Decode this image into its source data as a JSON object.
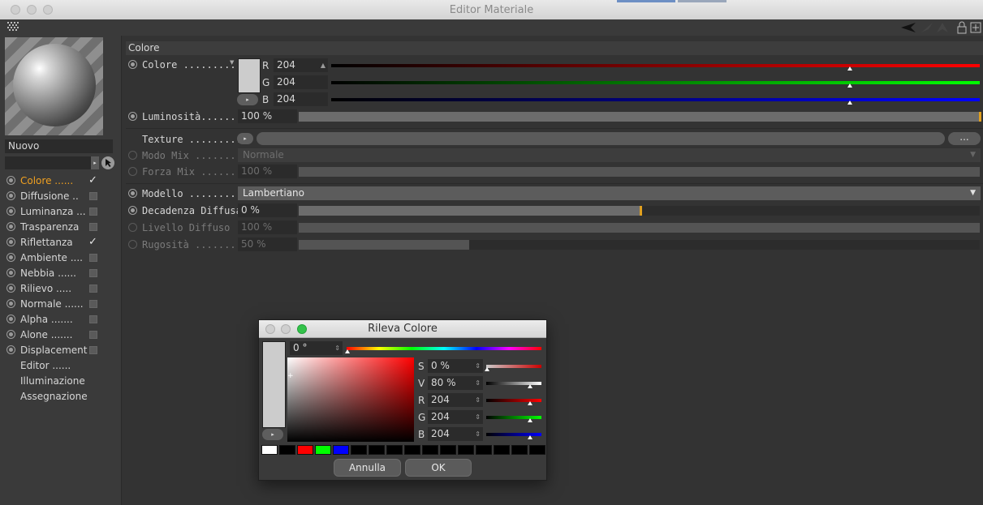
{
  "window": {
    "title": "Editor Materiale"
  },
  "material": {
    "name": "Nuovo"
  },
  "channels": [
    {
      "label": "Colore ......",
      "checked": true,
      "active": true
    },
    {
      "label": "Diffusione ..",
      "checked": false
    },
    {
      "label": "Luminanza ...",
      "checked": false
    },
    {
      "label": "Trasparenza",
      "checked": false
    },
    {
      "label": "Riflettanza",
      "checked": true
    },
    {
      "label": "Ambiente ....",
      "checked": false
    },
    {
      "label": "Nebbia ......",
      "checked": false
    },
    {
      "label": "Rilievo .....",
      "checked": false
    },
    {
      "label": "Normale ......",
      "checked": false
    },
    {
      "label": "Alpha .......",
      "checked": false
    },
    {
      "label": "Alone .......",
      "checked": false
    },
    {
      "label": "Displacement",
      "checked": false
    }
  ],
  "extra_items": [
    "Editor ......",
    "Illuminazione",
    "Assegnazione"
  ],
  "section": {
    "title": "Colore"
  },
  "color": {
    "label": "Colore .........",
    "r_label": "R",
    "g_label": "G",
    "b_label": "B",
    "r": "204",
    "g": "204",
    "b": "204",
    "swatch": "#cccccc",
    "slider_level": 0.8
  },
  "brightness": {
    "label": "Luminosità........",
    "value": "100 %",
    "level": 1.0
  },
  "texture": {
    "label": "Texture ..........",
    "dots": "..."
  },
  "mixmode": {
    "label": "Modo Mix ..........",
    "value": "Normale"
  },
  "mixstrength": {
    "label": "Forza Mix .........",
    "value": "100 %",
    "level": 1.0
  },
  "model": {
    "label": "Modello ...........",
    "value": "Lambertiano"
  },
  "diffusefalloff": {
    "label": "Decadenza Diffusa",
    "value": "0 %",
    "level": 0.5
  },
  "diffuselevel": {
    "label": "Livello Diffuso ..",
    "value": "100 %",
    "level": 1.0
  },
  "roughness": {
    "label": "Rugosità ..........",
    "value": "50 %",
    "level": 0.25
  },
  "dialog": {
    "title": "Rileva Colore",
    "hue": "0 °",
    "s_label": "S",
    "s": "0 %",
    "v_label": "V",
    "v": "80 %",
    "r_label": "R",
    "r": "204",
    "g_label": "G",
    "g": "204",
    "b_label": "B",
    "b": "204",
    "cancel": "Annulla",
    "ok": "OK",
    "swatches": [
      "#ffffff",
      "#000000",
      "#ff0000",
      "#00ff00",
      "#0000ff",
      "#000000",
      "#000000",
      "#000000",
      "#000000",
      "#000000",
      "#000000",
      "#000000",
      "#000000",
      "#000000",
      "#000000",
      "#000000"
    ]
  }
}
